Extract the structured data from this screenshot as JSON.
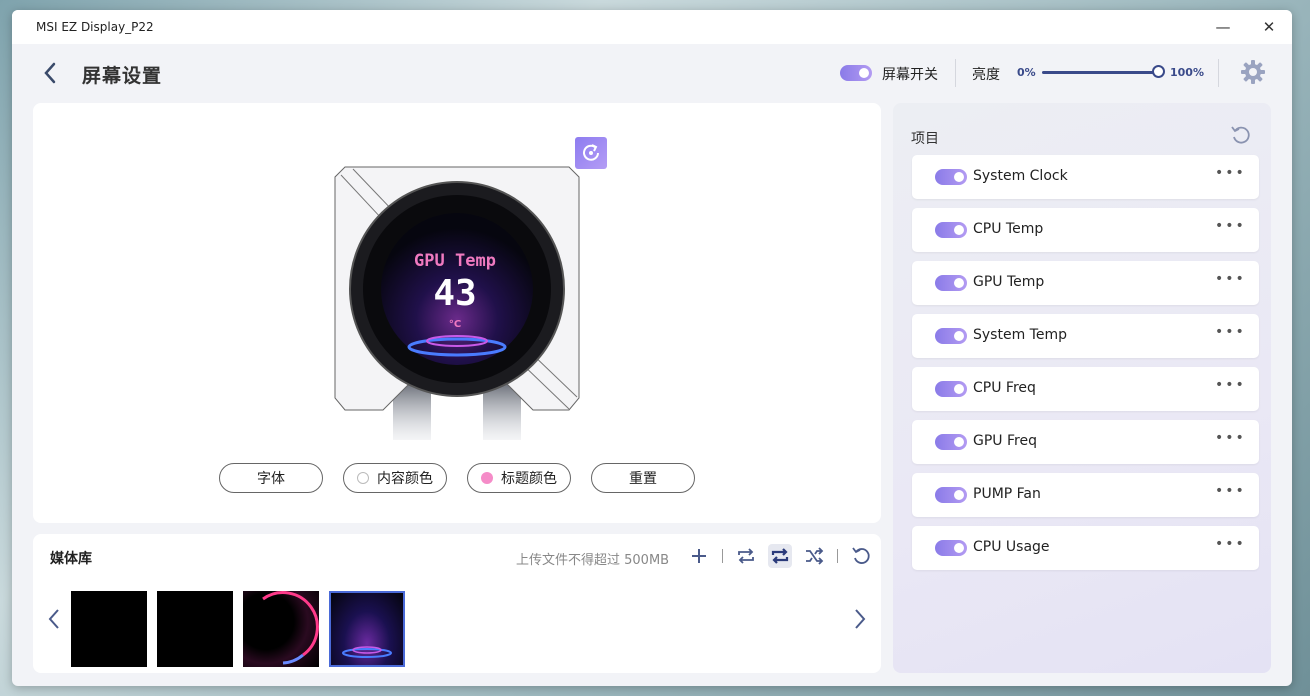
{
  "window": {
    "title": "MSI EZ Display_P22",
    "minimize_glyph": "—",
    "close_glyph": "✕"
  },
  "header": {
    "back_icon": "chevron-left-icon",
    "page_title": "屏幕设置",
    "screen_switch": {
      "label": "屏幕开关",
      "on": true
    },
    "brightness": {
      "label": "亮度",
      "min_label": "0%",
      "max_label": "100%",
      "value": 100
    },
    "settings_icon": "gear-icon"
  },
  "preview": {
    "lcd": {
      "title": "GPU Temp",
      "value": "43",
      "unit": "°C"
    },
    "buttons": {
      "font": "字体",
      "content_color": "内容颜色",
      "title_color": "标题颜色",
      "reset": "重置"
    },
    "colors": {
      "content_color": "#ffffff",
      "title_color": "#f07ac0"
    }
  },
  "media": {
    "title": "媒体库",
    "upload_limit": "上传文件不得超过 500MB",
    "thumbnails": [
      "black-1",
      "black-2",
      "neon-ring",
      "stage-light"
    ],
    "selected_index": 3
  },
  "items": {
    "title": "项目",
    "list": [
      {
        "label": "System Clock",
        "on": true
      },
      {
        "label": "CPU Temp",
        "on": true
      },
      {
        "label": "GPU Temp",
        "on": true
      },
      {
        "label": "System Temp",
        "on": true
      },
      {
        "label": "CPU Freq",
        "on": true
      },
      {
        "label": "GPU Freq",
        "on": true
      },
      {
        "label": "PUMP Fan",
        "on": true
      },
      {
        "label": "CPU Usage",
        "on": true
      }
    ],
    "more_glyph": "•••"
  },
  "accent": "#8a7be8",
  "brand_navy": "#3a4a8a"
}
